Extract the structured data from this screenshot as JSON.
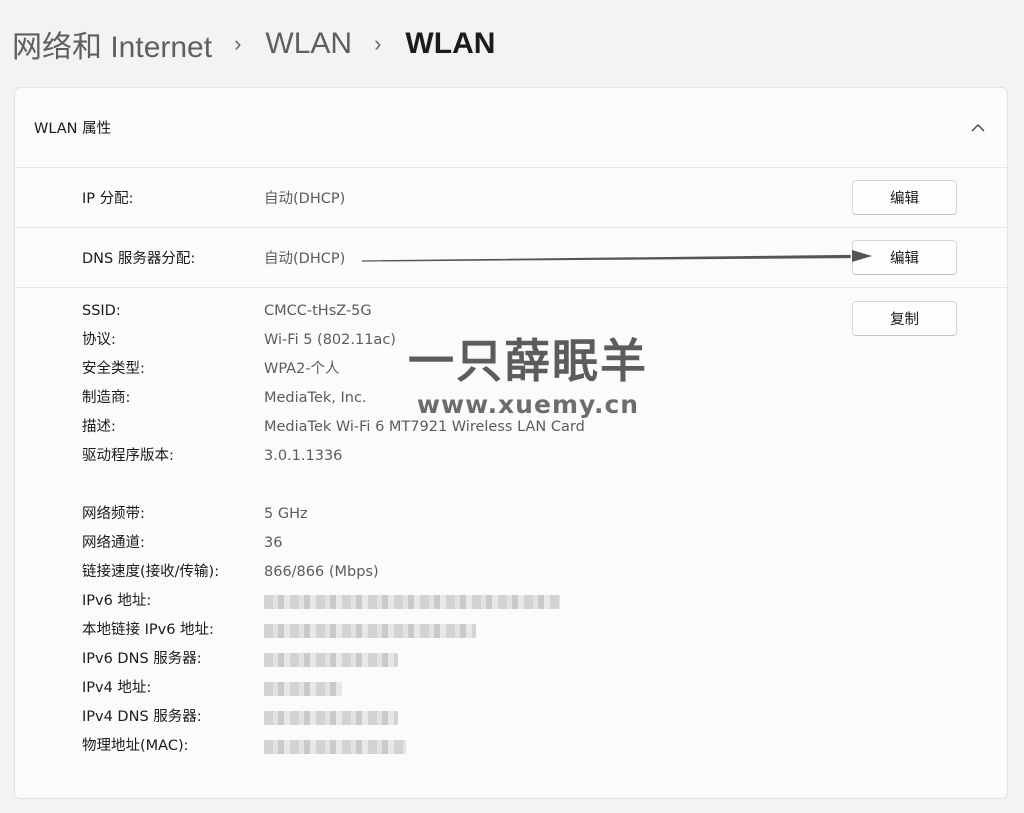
{
  "breadcrumb": {
    "items": [
      "网络和 Internet",
      "WLAN",
      "WLAN"
    ],
    "separator": "›"
  },
  "card": {
    "title": "WLAN 属性",
    "collapse_icon": "chevron-up-icon"
  },
  "rows": {
    "ip": {
      "label": "IP 分配:",
      "value": "自动(DHCP)",
      "button": "编辑"
    },
    "dns": {
      "label": "DNS 服务器分配:",
      "value": "自动(DHCP)",
      "button": "编辑"
    }
  },
  "details": {
    "copy_button": "复制",
    "items": [
      {
        "label": "SSID:",
        "value": "CMCC-tHsZ-5G"
      },
      {
        "label": "协议:",
        "value": "Wi-Fi 5 (802.11ac)"
      },
      {
        "label": "安全类型:",
        "value": "WPA2-个人"
      },
      {
        "label": "制造商:",
        "value": "MediaTek, Inc."
      },
      {
        "label": "描述:",
        "value": "MediaTek Wi-Fi 6 MT7921 Wireless LAN Card"
      },
      {
        "label": "驱动程序版本:",
        "value": "3.0.1.1336"
      },
      {
        "label": "网络频带:",
        "value": "5 GHz"
      },
      {
        "label": "网络通道:",
        "value": "36"
      },
      {
        "label": "链接速度(接收/传输):",
        "value": "866/866 (Mbps)"
      }
    ],
    "redacted": [
      {
        "label": "IPv6 地址:"
      },
      {
        "label": "本地链接 IPv6 地址:"
      },
      {
        "label": "IPv6 DNS 服务器:"
      },
      {
        "label": "IPv4 地址:"
      },
      {
        "label": "IPv4 DNS 服务器:"
      },
      {
        "label": "物理地址(MAC):"
      }
    ]
  },
  "watermark": {
    "line1": "一只薛眠羊",
    "line2": "www.xuemy.cn"
  },
  "colors": {
    "background": "#f3f3f3",
    "card": "#fbfbfb",
    "arrow": "#555555"
  }
}
